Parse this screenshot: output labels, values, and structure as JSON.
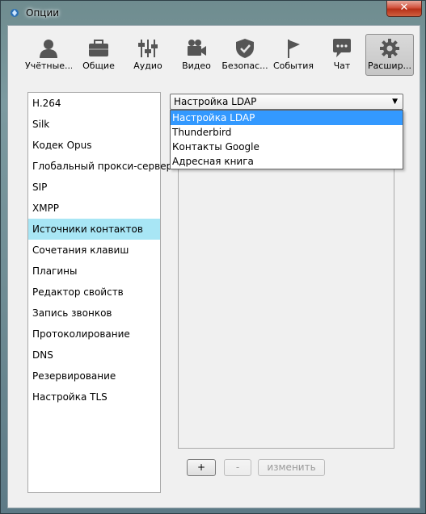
{
  "window": {
    "title": "Опции",
    "close_label": "✕"
  },
  "toolbar": {
    "items": [
      {
        "label": "Учётные...",
        "icon": "user-icon"
      },
      {
        "label": "Общие",
        "icon": "briefcase-icon"
      },
      {
        "label": "Аудио",
        "icon": "sliders-icon"
      },
      {
        "label": "Видео",
        "icon": "video-camera-icon"
      },
      {
        "label": "Безопас...",
        "icon": "shield-icon"
      },
      {
        "label": "События",
        "icon": "flag-icon"
      },
      {
        "label": "Чат",
        "icon": "chat-bubble-icon"
      },
      {
        "label": "Расшир...",
        "icon": "gear-icon",
        "active": true
      }
    ]
  },
  "sidebar": {
    "items": [
      {
        "label": "H.264"
      },
      {
        "label": "Silk"
      },
      {
        "label": "Кодек Opus"
      },
      {
        "label": "Глобальный прокси-сервер"
      },
      {
        "label": "SIP"
      },
      {
        "label": "XMPP"
      },
      {
        "label": "Источники контактов",
        "selected": true
      },
      {
        "label": "Сочетания клавиш"
      },
      {
        "label": "Плагины"
      },
      {
        "label": "Редактор свойств"
      },
      {
        "label": "Запись звонков"
      },
      {
        "label": "Протоколирование"
      },
      {
        "label": "DNS"
      },
      {
        "label": "Резервирование"
      },
      {
        "label": "Настройка TLS"
      }
    ]
  },
  "source_select": {
    "selected": "Настройка LDAP",
    "options": [
      "Настройка LDAP",
      "Thunderbird",
      "Контакты Google",
      "Адресная книга"
    ]
  },
  "buttons": {
    "add": "+",
    "remove": "-",
    "edit": "изменить"
  }
}
